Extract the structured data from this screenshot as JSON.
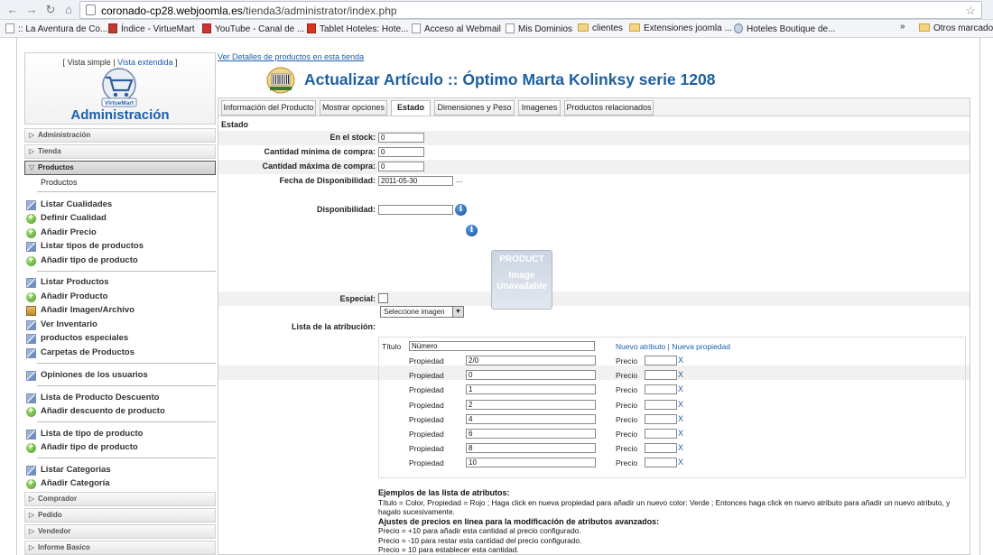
{
  "browser": {
    "url_host": "coronado-cp28.webjoomla.es",
    "url_path": "/tienda3/administrator/index.php",
    "bookmarks": [
      {
        "label": ":: La Aventura de Co...",
        "icon": "page-icon"
      },
      {
        "label": "Índice - VirtueMart",
        "icon": "virtuemart-icon"
      },
      {
        "label": "YouTube - Canal de ...",
        "icon": "youtube-icon"
      },
      {
        "label": "Tablet Hoteles: Hote...",
        "icon": "tablet-icon"
      },
      {
        "label": "Acceso al Webmail",
        "icon": "page-icon"
      },
      {
        "label": "Mis Dominios",
        "icon": "page-icon"
      },
      {
        "label": "clientes",
        "icon": "folder-icon"
      },
      {
        "label": "Extensiones joomla ...",
        "icon": "folder-icon"
      },
      {
        "label": "Hoteles Boutique de...",
        "icon": "globe-icon"
      },
      {
        "label": "»",
        "icon": ""
      },
      {
        "label": "Otros marcadores",
        "icon": "folder-icon"
      }
    ]
  },
  "sidebar": {
    "view_simple": "[ Vista simple",
    "separator": " | ",
    "view_extended": "Vista extendida",
    "view_close": " ]",
    "logo_text": "VirtueMart",
    "title": "Administración",
    "sections": {
      "administracion": "Administración",
      "tienda": "Tienda",
      "productos": "Productos",
      "comprador": "Comprador",
      "pedido": "Pedido",
      "vendedor": "Vendedor",
      "informe": "Informe Basico"
    },
    "productos_sub": "Productos",
    "items": [
      "Listar Cualidades",
      "Definir Cualidad",
      "Añadir Precio",
      "Listar tipos de productos",
      "Añadir tipo de producto",
      "Listar Productos",
      "Añadir Producto",
      "Añadir Imagen/Archivo",
      "Ver Inventario",
      "productos especiales",
      "Carpetas de Productos",
      "Opiniones de los usuarios",
      "Lista de Producto Descuento",
      "Añadir descuento de producto",
      "Lista de tipo de producto",
      "Añadir tipo de producto",
      "Listar Categorias",
      "Añadir Categoría"
    ]
  },
  "main": {
    "details_link": "Ver Detalles de productos en esta tienda",
    "heading": "Actualizar Artículo :: Óptimo Marta Kolinksy serie 1208",
    "tabs": [
      "Información del Producto",
      "Mostrar opciones",
      "Estado",
      "Dimensiones y Peso",
      "Imagenes",
      "Productos relacionados"
    ],
    "section_title": "Estado",
    "fields": {
      "stock_label": "En el stock:",
      "stock_value": "0",
      "min_label": "Cantidad mínima de compra:",
      "min_value": "0",
      "max_label": "Cantidad máxima de compra:",
      "max_value": "0",
      "date_label": "Fecha de Disponibilidad:",
      "date_value": "2011-05-30",
      "date_ellipsis": "...",
      "availability_label": "Disponibilidad:",
      "availability_value": "",
      "image_line1": "PRODUCT",
      "image_line2": "Image Unavailable",
      "image_select": "Seleccione imagen",
      "special_label": "Especial:",
      "attr_label": "Lista de la atribución:"
    },
    "attributes": {
      "title_label": "Título",
      "title_value": "Número",
      "new_attribute": "Nuevo atributo",
      "link_sep": " | ",
      "new_property": "Nueva propiedad",
      "property_label": "Propiedad",
      "price_label": "Precio",
      "remove": "X",
      "properties": [
        "2/0",
        "0",
        "1",
        "2",
        "4",
        "6",
        "8",
        "10"
      ]
    },
    "examples": {
      "heading1": "Ejemplos de las lista de atributos:",
      "text1": "Título = Color, Propiedad = Rojo ; Haga click en nueva propiedad para añadir un nuevo color: Verde ; Entonces haga click en nuevo atributo para añadir un nuevo atributo, y hagalo sucesivamente.",
      "heading2": "Ajustes de precios en línea para la modificación de atributos avanzados:",
      "line1": "Precio = +10 para añadir esta cantidad al precio configurado.",
      "line2": "Precio = -10 para restar esta cantidad del precio configurado.",
      "line3": "Precio = 10 para establecer esta cantidad."
    }
  }
}
